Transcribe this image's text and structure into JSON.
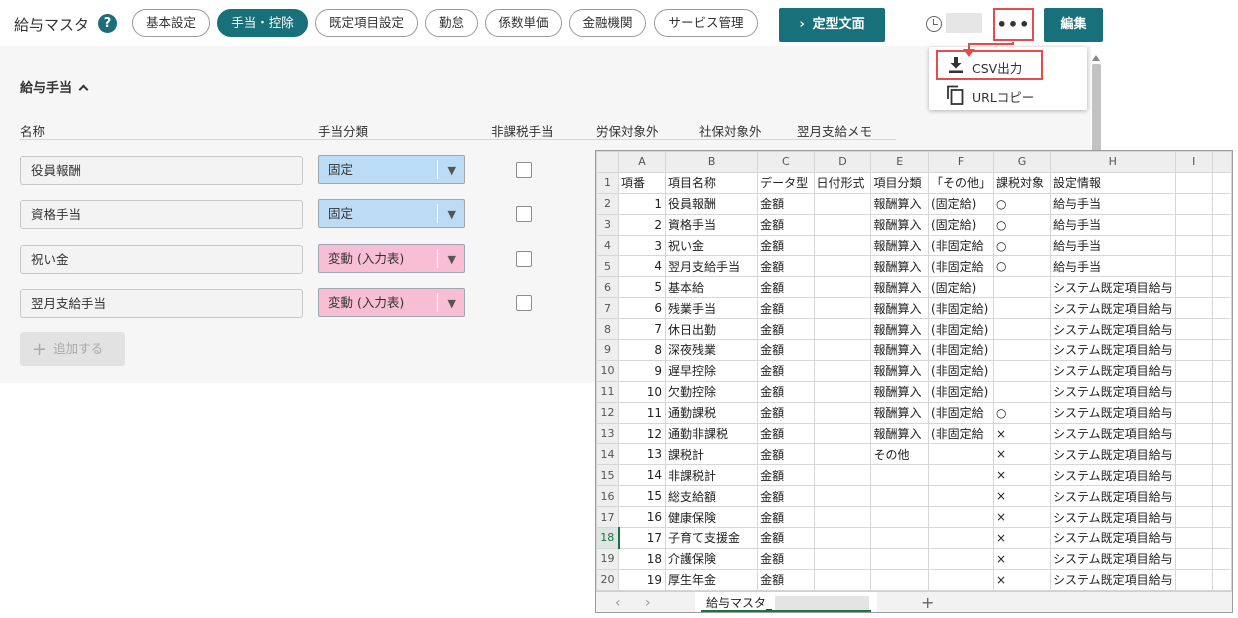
{
  "header": {
    "title": "給与マスタ",
    "help": "?",
    "tabs": [
      "基本設定",
      "手当・控除",
      "既定項目設定",
      "勤怠",
      "係数単価",
      "金融機関",
      "サービス管理"
    ],
    "active_tab": "手当・控除",
    "template_button": "定型文面",
    "more_button": "•••",
    "edit_button": "編集"
  },
  "menu": {
    "items": [
      "CSV出力",
      "URLコピー"
    ]
  },
  "allowances": {
    "section_title": "給与手当",
    "columns": [
      "名称",
      "手当分類",
      "非課税手当",
      "労保対象外",
      "社保対象外",
      "翌月支給メモ"
    ],
    "rows": [
      {
        "name": "役員報酬",
        "category": "固定",
        "kind": "fixed"
      },
      {
        "name": "資格手当",
        "category": "固定",
        "kind": "fixed"
      },
      {
        "name": "祝い金",
        "category": "変動 (入力表)",
        "kind": "var"
      },
      {
        "name": "翌月支給手当",
        "category": "変動 (入力表)",
        "kind": "var"
      }
    ],
    "add_button": "追加する"
  },
  "spreadsheet": {
    "columns": [
      "A",
      "B",
      "C",
      "D",
      "E",
      "F",
      "G",
      "H",
      "I"
    ],
    "row_numbers": [
      "1",
      "2",
      "3",
      "4",
      "5",
      "6",
      "7",
      "8",
      "9",
      "10",
      "11",
      "12",
      "13",
      "14",
      "15",
      "16",
      "17",
      "18",
      "19",
      "20"
    ],
    "selected_row": "18",
    "rows": [
      [
        "項番",
        "項目名称",
        "データ型",
        "日付形式",
        "項目分類",
        "「その他」",
        "課税対象",
        "設定情報",
        ""
      ],
      [
        "1",
        "役員報酬",
        "金額",
        "",
        "報酬算入",
        "(固定給)",
        "○",
        "給与手当",
        ""
      ],
      [
        "2",
        "資格手当",
        "金額",
        "",
        "報酬算入",
        "(固定給)",
        "○",
        "給与手当",
        ""
      ],
      [
        "3",
        "祝い金",
        "金額",
        "",
        "報酬算入",
        "(非固定給",
        "○",
        "給与手当",
        ""
      ],
      [
        "4",
        "翌月支給手当",
        "金額",
        "",
        "報酬算入",
        "(非固定給",
        "○",
        "給与手当",
        ""
      ],
      [
        "5",
        "基本給",
        "金額",
        "",
        "報酬算入",
        "(固定給)",
        "",
        "システム既定項目給与",
        ""
      ],
      [
        "6",
        "残業手当",
        "金額",
        "",
        "報酬算入",
        "(非固定給)",
        "",
        "システム既定項目給与",
        ""
      ],
      [
        "7",
        "休日出勤",
        "金額",
        "",
        "報酬算入",
        "(非固定給)",
        "",
        "システム既定項目給与",
        ""
      ],
      [
        "8",
        "深夜残業",
        "金額",
        "",
        "報酬算入",
        "(非固定給)",
        "",
        "システム既定項目給与",
        ""
      ],
      [
        "9",
        "遅早控除",
        "金額",
        "",
        "報酬算入",
        "(非固定給)",
        "",
        "システム既定項目給与",
        ""
      ],
      [
        "10",
        "欠勤控除",
        "金額",
        "",
        "報酬算入",
        "(非固定給)",
        "",
        "システム既定項目給与",
        ""
      ],
      [
        "11",
        "通勤課税",
        "金額",
        "",
        "報酬算入",
        "(非固定給",
        "○",
        "システム既定項目給与",
        ""
      ],
      [
        "12",
        "通勤非課税",
        "金額",
        "",
        "報酬算入",
        "(非固定給",
        "×",
        "システム既定項目給与",
        ""
      ],
      [
        "13",
        "課税計",
        "金額",
        "",
        "その他",
        "",
        "×",
        "システム既定項目給与",
        ""
      ],
      [
        "14",
        "非課税計",
        "金額",
        "",
        "",
        "",
        "×",
        "システム既定項目給与",
        ""
      ],
      [
        "15",
        "総支給額",
        "金額",
        "",
        "",
        "",
        "×",
        "システム既定項目給与",
        ""
      ],
      [
        "16",
        "健康保険",
        "金額",
        "",
        "",
        "",
        "×",
        "システム既定項目給与",
        ""
      ],
      [
        "17",
        "子育て支援金",
        "金額",
        "",
        "",
        "",
        "×",
        "システム既定項目給与",
        ""
      ],
      [
        "18",
        "介護保険",
        "金額",
        "",
        "",
        "",
        "×",
        "システム既定項目給与",
        ""
      ],
      [
        "19",
        "厚生年金",
        "金額",
        "",
        "",
        "",
        "×",
        "システム既定項目給与",
        ""
      ]
    ],
    "sheet_tab": "給与マスタ_",
    "add_sheet": "+",
    "nav_prev": "‹",
    "nav_next": "›"
  },
  "colors": {
    "accent": "#17707a",
    "highlight": "#e74c4c",
    "fixed": "#bcdcf6",
    "variable": "#f8bed4",
    "excel_green": "#1a7342"
  },
  "icons": [
    "help-icon",
    "history-icon",
    "download-icon",
    "copy-icon",
    "chevron-up-icon",
    "plus-icon",
    "dropdown-arrow-icon"
  ]
}
